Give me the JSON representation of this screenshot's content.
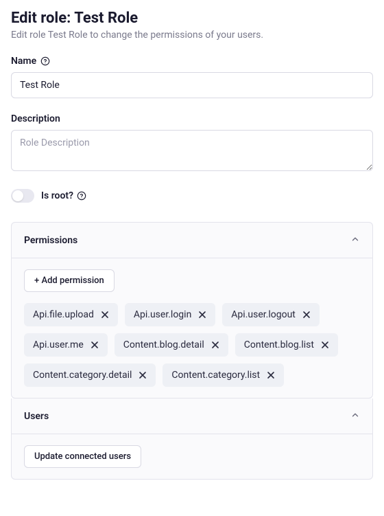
{
  "header": {
    "title": "Edit role: Test Role",
    "subtitle": "Edit role Test Role to change the permissions of your users."
  },
  "name_field": {
    "label": "Name",
    "value": "Test Role"
  },
  "description_field": {
    "label": "Description",
    "placeholder": "Role Description",
    "value": ""
  },
  "is_root": {
    "label": "Is root?",
    "value": false
  },
  "permissions_panel": {
    "title": "Permissions",
    "add_button": "+ Add permission",
    "tags": [
      "Api.file.upload",
      "Api.user.login",
      "Api.user.logout",
      "Api.user.me",
      "Content.blog.detail",
      "Content.blog.list",
      "Content.category.detail",
      "Content.category.list"
    ]
  },
  "users_panel": {
    "title": "Users",
    "update_button": "Update connected users"
  }
}
